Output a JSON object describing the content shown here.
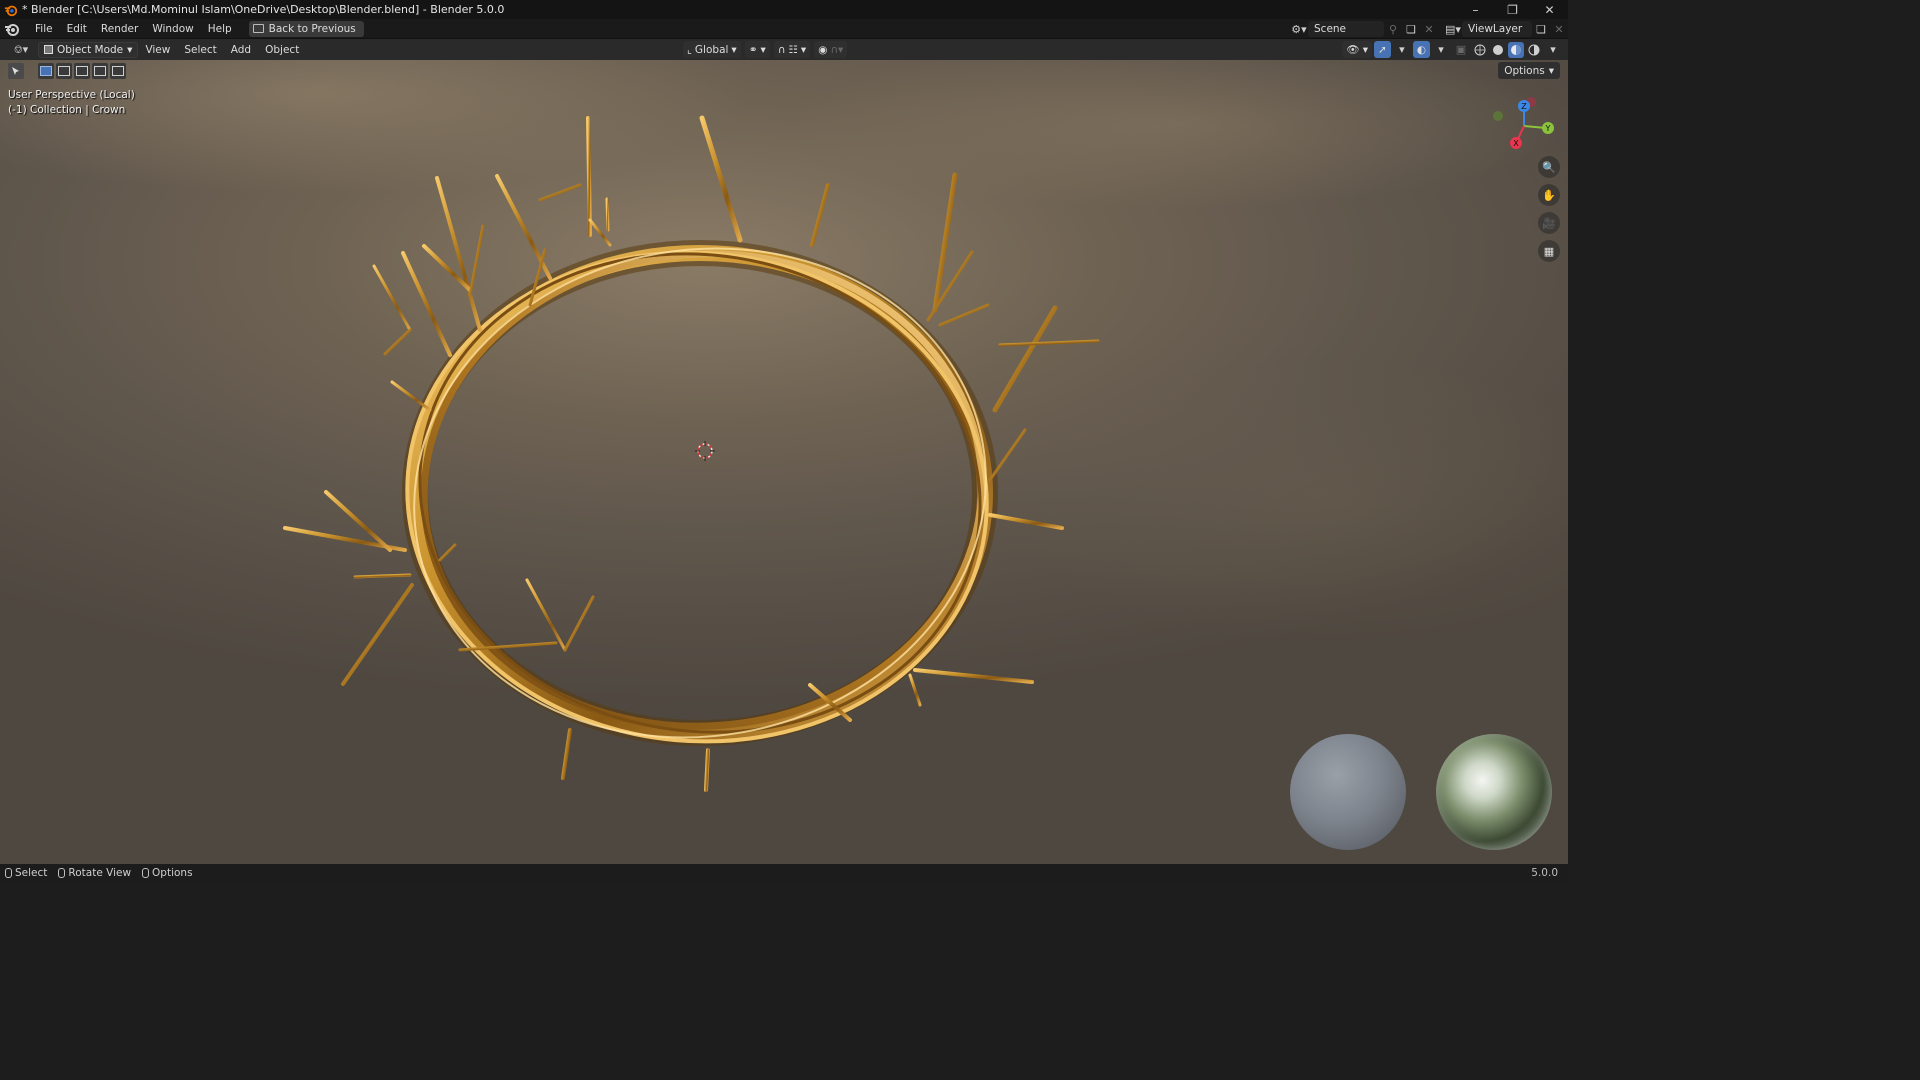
{
  "window": {
    "title": "* Blender [C:\\Users\\Md.Mominul Islam\\OneDrive\\Desktop\\Blender.blend] - Blender 5.0.0",
    "controls": [
      "minimize-icon",
      "restore-icon",
      "close-icon"
    ]
  },
  "menubar": {
    "items": [
      "File",
      "Edit",
      "Render",
      "Window",
      "Help"
    ],
    "back_button": "Back to Previous",
    "scene": "Scene",
    "view_layer": "ViewLayer"
  },
  "viewport_header": {
    "mode": "Object Mode",
    "menus": [
      "View",
      "Select",
      "Add",
      "Object"
    ],
    "transform_orientation": "Global",
    "shading_modes": [
      "wireframe",
      "solid",
      "material-preview",
      "rendered"
    ],
    "active_shading": "material-preview"
  },
  "viewport": {
    "options_label": "Options",
    "overlay_line1": "User Perspective (Local)",
    "overlay_line2": "(-1) Collection | Crown",
    "gizmo_axes": {
      "x": "X",
      "y": "Y",
      "z": "Z"
    },
    "colors": {
      "x_axis": "#e8364f",
      "y_axis": "#8bc43c",
      "z_axis": "#3b88e8",
      "crown_gold": "#c9922e"
    }
  },
  "statusbar": {
    "hints": [
      "Select",
      "Rotate View",
      "Options"
    ],
    "version": "5.0.0"
  }
}
